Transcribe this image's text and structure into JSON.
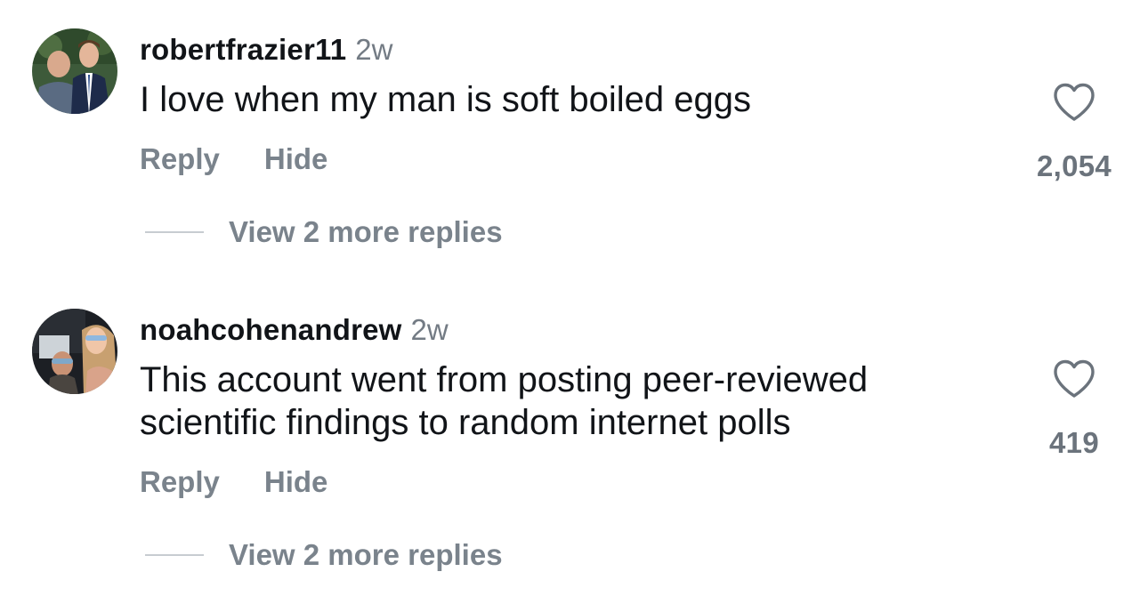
{
  "comments": [
    {
      "username": "robertfrazier11",
      "time": "2w",
      "text": "I love when my man is soft boiled eggs",
      "reply_label": "Reply",
      "hide_label": "Hide",
      "view_replies": "View 2 more replies",
      "likes": "2,054",
      "avatar_icon": "avatar-photo-two-men"
    },
    {
      "username": "noahcohenandrew",
      "time": "2w",
      "text": "This account went from posting peer-reviewed scientific findings to random internet polls",
      "reply_label": "Reply",
      "hide_label": "Hide",
      "view_replies": "View 2 more replies",
      "likes": "419",
      "avatar_icon": "avatar-photo-selfie-car"
    }
  ],
  "colors": {
    "username": "#111418",
    "muted": "#7a838c",
    "divider": "#c7ccd1",
    "heart_stroke": "#6b737c"
  }
}
